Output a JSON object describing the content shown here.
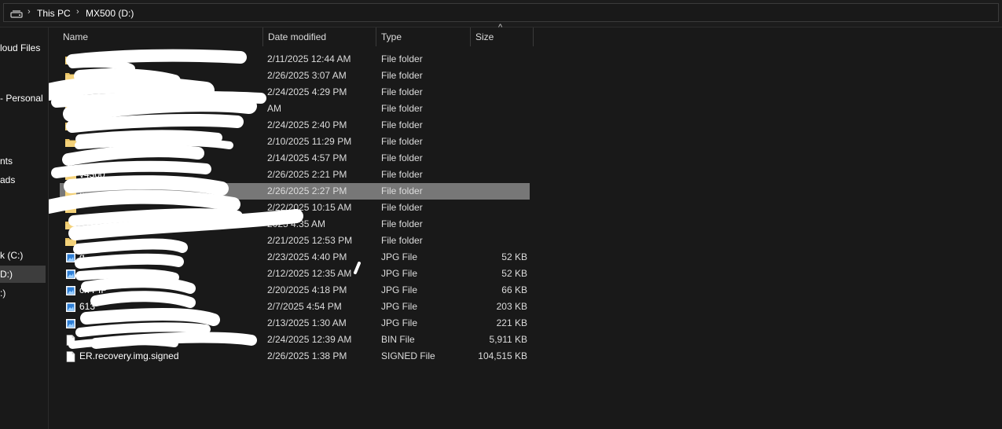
{
  "address_bar": {
    "crumbs": [
      "This PC",
      "MX500 (D:)"
    ]
  },
  "nav_pane": {
    "items": [
      {
        "label": "loud Files",
        "icon": "cloud-icon"
      },
      {
        "label": "- Personal",
        "icon": "onedrive-icon"
      },
      {
        "label": "nts",
        "icon": "documents-icon"
      },
      {
        "label": "ads",
        "icon": "downloads-icon"
      },
      {
        "label": "k (C:)",
        "icon": "drive-icon"
      },
      {
        "label": "D:)",
        "icon": "drive-icon",
        "selected": true
      },
      {
        "label": ":)",
        "icon": "drive-icon"
      }
    ]
  },
  "columns": {
    "name": "Name",
    "date": "Date modified",
    "type": "Type",
    "size": "Size"
  },
  "files": [
    {
      "name": "",
      "date": "2/11/2025 12:44 AM",
      "type": "File folder",
      "size": "",
      "icon": "folder-icon"
    },
    {
      "name": "",
      "date": "2/26/2025 3:07 AM",
      "type": "File folder",
      "size": "",
      "icon": "folder-icon"
    },
    {
      "name": "",
      "date": "2/24/2025 4:29 PM",
      "type": "File folder",
      "size": "",
      "icon": "folder-icon"
    },
    {
      "name": "",
      "date": "AM",
      "type": "File folder",
      "size": "",
      "icon": "folder-icon"
    },
    {
      "name": "",
      "date": "2/24/2025 2:40 PM",
      "type": "File folder",
      "size": "",
      "icon": "folder-icon"
    },
    {
      "name": "",
      "date": "2/10/2025 11:29 PM",
      "type": "File folder",
      "size": "",
      "icon": "folder-icon"
    },
    {
      "name": "",
      "date": "2/14/2025 4:57 PM",
      "type": "File folder",
      "size": "",
      "icon": "folder-icon"
    },
    {
      "name": "v4300",
      "date": "2/26/2025 2:21 PM",
      "type": "File folder",
      "size": "",
      "icon": "folder-icon"
    },
    {
      "name": "...",
      "date": "2/26/2025 2:27 PM",
      "type": "File folder",
      "size": "",
      "icon": "folder-icon",
      "selected": true
    },
    {
      "name": "",
      "date": "2/22/2025 10:15 AM",
      "type": "File folder",
      "size": "",
      "icon": "folder-icon"
    },
    {
      "name": "",
      "date": "2025 4:35 AM",
      "type": "File folder",
      "size": "",
      "icon": "folder-icon"
    },
    {
      "name": "",
      "date": "2/21/2025 12:53 PM",
      "type": "File folder",
      "size": "",
      "icon": "folder-icon"
    },
    {
      "name": "g",
      "date": "2/23/2025 4:40 PM",
      "type": "JPG File",
      "size": "52 KB",
      "icon": "image-file-icon"
    },
    {
      "name": "",
      "date": "2/12/2025 12:35 AM",
      "type": "JPG File",
      "size": "52 KB",
      "icon": "image-file-icon"
    },
    {
      "name": "ch PfP _' '...",
      "date": "2/20/2025 4:18 PM",
      "type": "JPG File",
      "size": "66 KB",
      "icon": "image-file-icon"
    },
    {
      "name": "613",
      "date": "2/7/2025 4:54 PM",
      "type": "JPG File",
      "size": "203 KB",
      "icon": "image-file-icon"
    },
    {
      "name": "",
      "date": "2/13/2025 1:30 AM",
      "type": "JPG File",
      "size": "221 KB",
      "icon": "image-file-icon"
    },
    {
      "name": "",
      "date": "2/24/2025 12:39 AM",
      "type": "BIN File",
      "size": "5,911 KB",
      "icon": "file-icon"
    },
    {
      "name": "ER.recovery.img.signed",
      "date": "2/26/2025 1:38 PM",
      "type": "SIGNED File",
      "size": "104,515 KB",
      "icon": "file-icon"
    }
  ],
  "colors": {
    "background": "#191919",
    "selected_row": "#777777",
    "folder": "#e8c263",
    "redaction": "#ffffff"
  }
}
